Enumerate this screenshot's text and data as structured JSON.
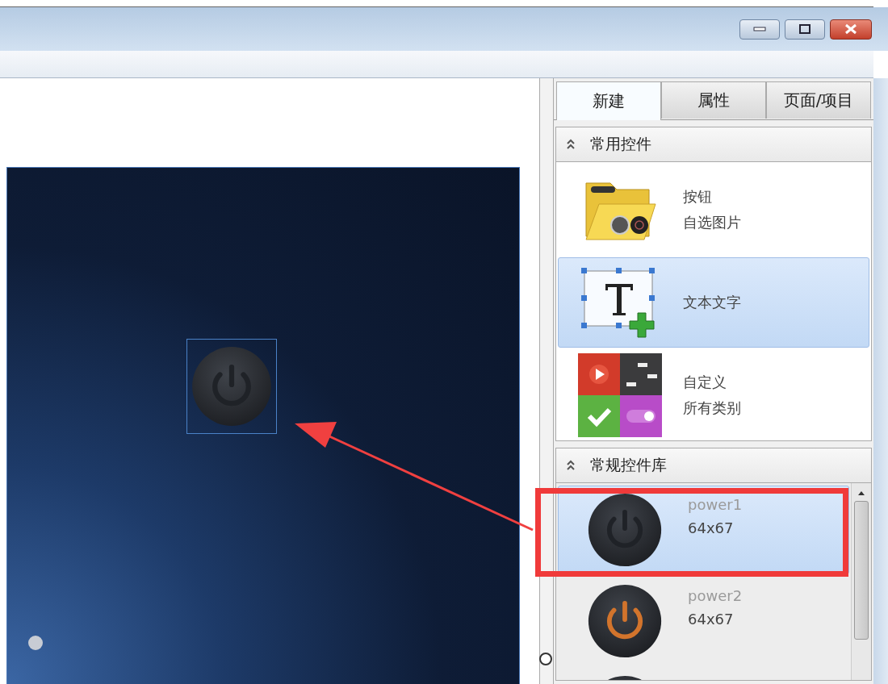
{
  "tabs": [
    {
      "label": "新建",
      "selected": true
    },
    {
      "label": "属性",
      "selected": false
    },
    {
      "label": "页面/项目",
      "selected": false
    }
  ],
  "sections": [
    {
      "title": "常用控件",
      "expanded": true,
      "items": [
        {
          "kind": "folder",
          "title": "按钮",
          "subtitle": "自选图片",
          "selected": false
        },
        {
          "kind": "text",
          "title": "文本文字",
          "selected": true
        },
        {
          "kind": "custom",
          "title": "自定义",
          "subtitle": "所有类别",
          "selected": false
        }
      ]
    },
    {
      "title": "常规控件库",
      "expanded": true,
      "items": [
        {
          "kind": "power",
          "title": "power1",
          "subtitle": "64x67",
          "selected": true,
          "color": "#1f2227"
        },
        {
          "kind": "power",
          "title": "power2",
          "subtitle": "64x67",
          "selected": false,
          "color": "#d2742c"
        },
        {
          "kind": "power",
          "selected": false,
          "color": "#2a2d33"
        }
      ]
    }
  ],
  "canvas": {
    "widget": {
      "selected": true,
      "color": "#1f2227"
    }
  }
}
